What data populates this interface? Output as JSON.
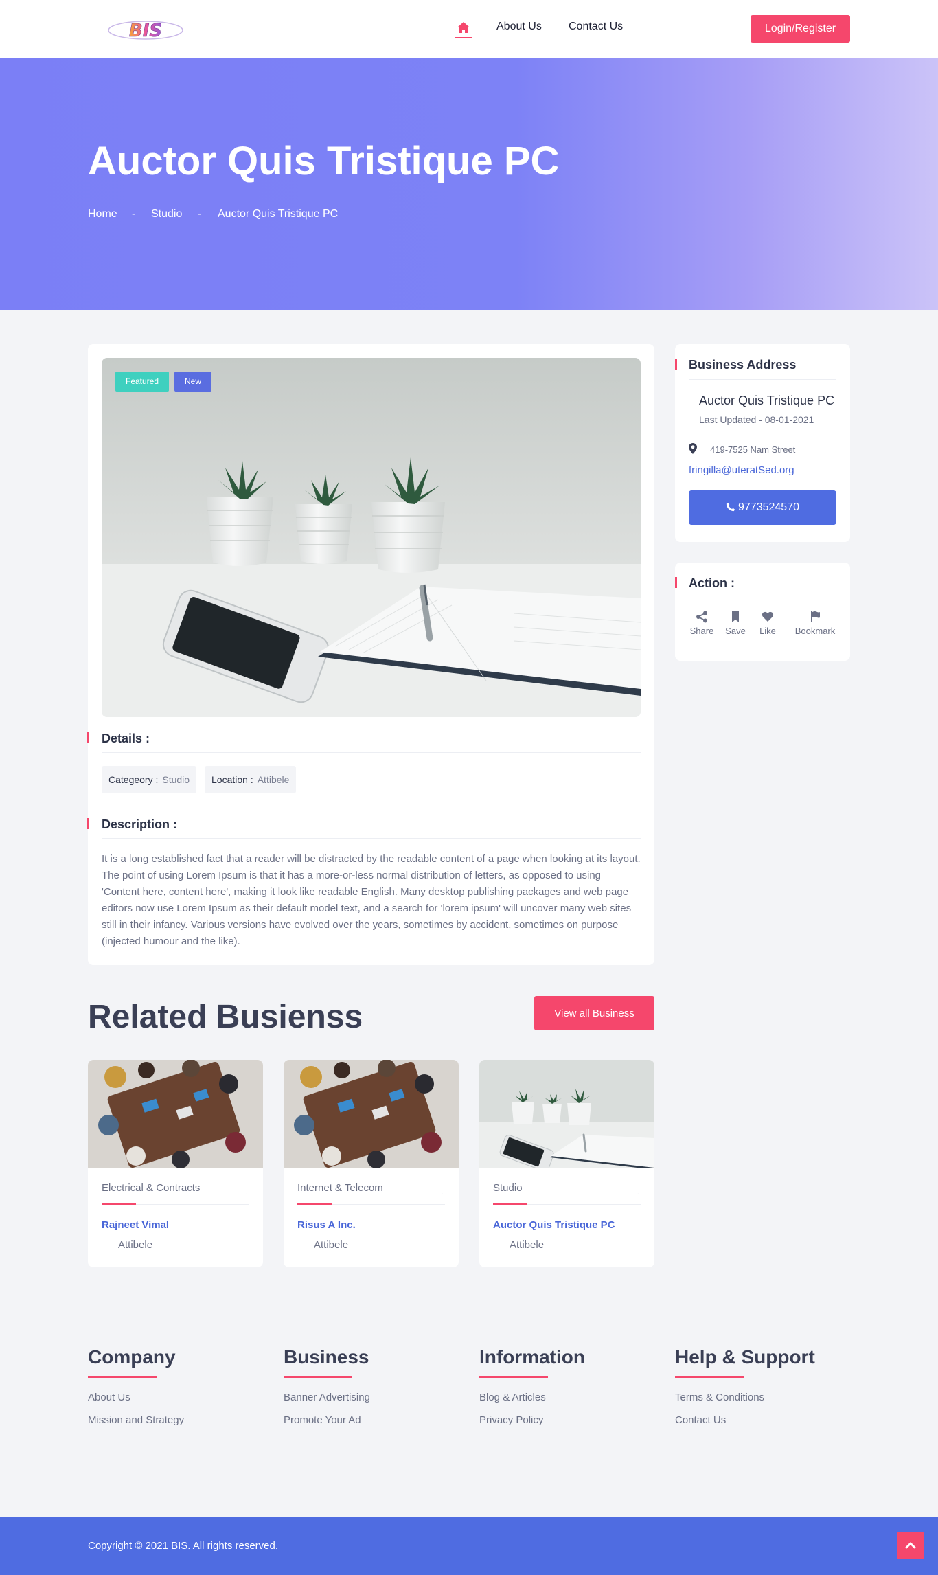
{
  "brand": {
    "logo_text": "BIS"
  },
  "nav": {
    "home_icon": "home-icon",
    "about": "About Us",
    "contact": "Contact Us",
    "login": "Login/Register"
  },
  "hero": {
    "title": "Auctor Quis Tristique PC",
    "breadcrumb": {
      "home": "Home",
      "sep": "-",
      "category": "Studio",
      "current": "Auctor Quis Tristique PC"
    }
  },
  "listing": {
    "badges": {
      "featured": "Featured",
      "new": "New"
    },
    "details_heading": "Details :",
    "category_label": "Categeory :",
    "category_value": "Studio",
    "location_label": "Location :",
    "location_value": "Attibele",
    "description_heading": "Description :",
    "description": "It is a long established fact that a reader will be distracted by the readable content of a page when looking at its layout. The point of using Lorem Ipsum is that it has a more-or-less normal distribution of letters, as opposed to using 'Content here, content here', making it look like readable English. Many desktop publishing packages and web page editors now use Lorem Ipsum as their default model text, and a search for 'lorem ipsum' will uncover many web sites still in their infancy. Various versions have evolved over the years, sometimes by accident, sometimes on purpose (injected humour and the like)."
  },
  "address": {
    "heading": "Business Address",
    "name": "Auctor Quis Tristique PC",
    "updated": "Last Updated - 08-01-2021",
    "street": "419-7525 Nam Street",
    "email": "fringilla@uteratSed.org",
    "phone": "9773524570"
  },
  "actions": {
    "heading": "Action :",
    "share": "Share",
    "save": "Save",
    "like": "Like",
    "bookmark": "Bookmark"
  },
  "related": {
    "title": "Related Busienss",
    "view_all": "View all Business",
    "items": [
      {
        "category": "Electrical & Contracts",
        "name": "Rajneet Vimal",
        "location": "Attibele",
        "image": "office-meeting-photo"
      },
      {
        "category": "Internet & Telecom",
        "name": "Risus A Inc.",
        "location": "Attibele",
        "image": "office-meeting-photo"
      },
      {
        "category": "Studio",
        "name": "Auctor Quis Tristique PC",
        "location": "Attibele",
        "image": "desk-plants-photo"
      }
    ]
  },
  "footer": {
    "columns": [
      {
        "heading": "Company",
        "links": [
          "About Us",
          "Mission and Strategy"
        ]
      },
      {
        "heading": "Business",
        "links": [
          "Banner Advertising",
          "Promote Your Ad"
        ]
      },
      {
        "heading": "Information",
        "links": [
          "Blog & Articles",
          "Privacy Policy"
        ]
      },
      {
        "heading": "Help & Support",
        "links": [
          "Terms & Conditions",
          "Contact Us"
        ]
      }
    ],
    "copyright": "Copyright © 2021 BIS. All rights reserved."
  },
  "colors": {
    "accent": "#f5476c",
    "primary": "#4f6ce1",
    "hero_start": "#7b7ff6",
    "hero_end": "#cbc3f8",
    "teal": "#3fd0bf"
  }
}
